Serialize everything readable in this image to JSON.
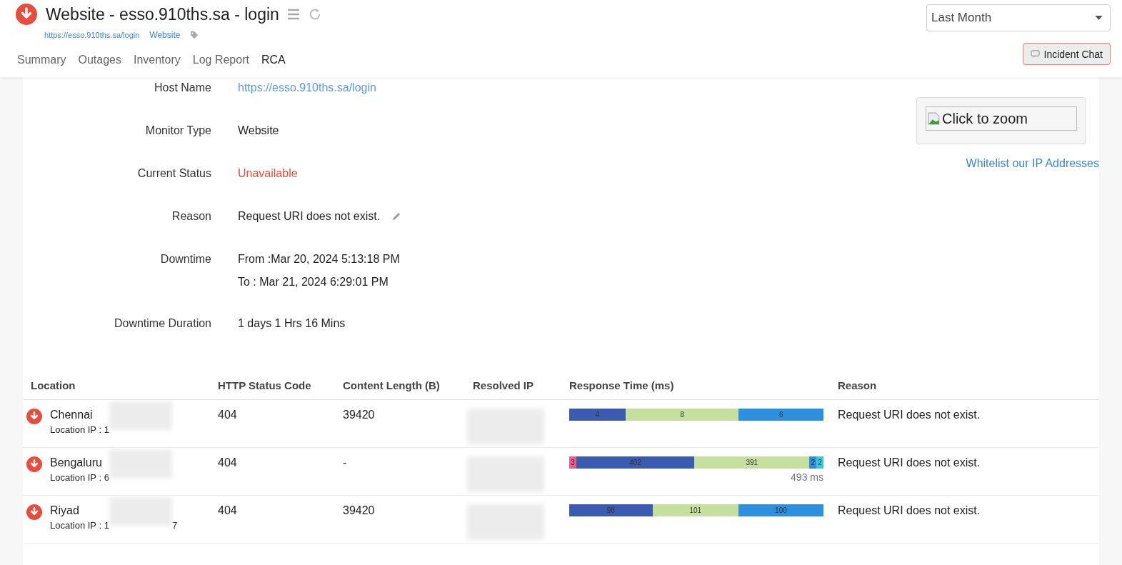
{
  "header": {
    "down": true,
    "title": "Website - esso.910ths.sa - login",
    "url": "https://esso.910ths.sa/login",
    "type_link": "Website"
  },
  "tabs": [
    {
      "label": "Summary",
      "selected": false
    },
    {
      "label": "Outages",
      "selected": false
    },
    {
      "label": "Inventory",
      "selected": false
    },
    {
      "label": "Log Report",
      "selected": false
    },
    {
      "label": "RCA",
      "selected": true
    }
  ],
  "period": {
    "value": "Last Month"
  },
  "incident_chat": "Incident Chat",
  "details": [
    {
      "kind": "link",
      "label": "Host Name",
      "values": [
        "https://esso.910ths.sa/login"
      ]
    },
    {
      "kind": "text",
      "label": "Monitor Type",
      "values": [
        "Website"
      ]
    },
    {
      "kind": "status",
      "label": "Current Status",
      "values": [
        "Unavailable"
      ]
    },
    {
      "kind": "editable",
      "label": "Reason",
      "values": [
        "Request URI does not exist."
      ]
    },
    {
      "kind": "text",
      "label": "Downtime",
      "values": [
        "From :Mar 20, 2024 5:13:18 PM",
        "To : Mar 21, 2024 6:29:01 PM"
      ]
    },
    {
      "kind": "text",
      "label": "Downtime Duration",
      "values": [
        "1 days 1 Hrs 16 Mins"
      ]
    }
  ],
  "screenshot": {
    "alt": "Click to zoom"
  },
  "whitelist_link": "Whitelist our IP Addresses",
  "table": {
    "columns": [
      "Location",
      "HTTP Status Code",
      "Content Length (B)",
      "Resolved IP",
      "Response Time (ms)",
      "Reason"
    ],
    "rows": [
      {
        "down": true,
        "location": "Chennai",
        "location_ip": "Location IP : 1",
        "ip_tail": "",
        "code": "404",
        "length": "39420",
        "segments": [
          {
            "value": "4",
            "color": "#3a5bb0"
          },
          {
            "value": "8",
            "color": "#c5e09e"
          },
          {
            "value": "6",
            "color": "#2e8fdd"
          }
        ],
        "total": "",
        "reason": "Request URI does not exist."
      },
      {
        "down": true,
        "location": "Bengaluru",
        "location_ip": "Location IP : 6",
        "ip_tail": "",
        "code": "404",
        "length": "-",
        "segments": [
          {
            "value": "3",
            "color": "#f2588a"
          },
          {
            "value": "402",
            "color": "#3a5bb0"
          },
          {
            "value": "391",
            "color": "#c5e09e"
          },
          {
            "value": "2",
            "color": "#2e8fdd"
          },
          {
            "value": "2",
            "color": "#34c9dc"
          }
        ],
        "total": "493 ms",
        "reason": "Request URI does not exist."
      },
      {
        "down": true,
        "location": "Riyad",
        "location_ip": "Location IP : 1",
        "ip_tail": "7",
        "code": "404",
        "length": "39420",
        "segments": [
          {
            "value": "98",
            "color": "#3a5bb0"
          },
          {
            "value": "101",
            "color": "#c5e09e"
          },
          {
            "value": "100",
            "color": "#2e8fdd"
          }
        ],
        "total": "",
        "reason": "Request URI does not exist."
      }
    ]
  }
}
